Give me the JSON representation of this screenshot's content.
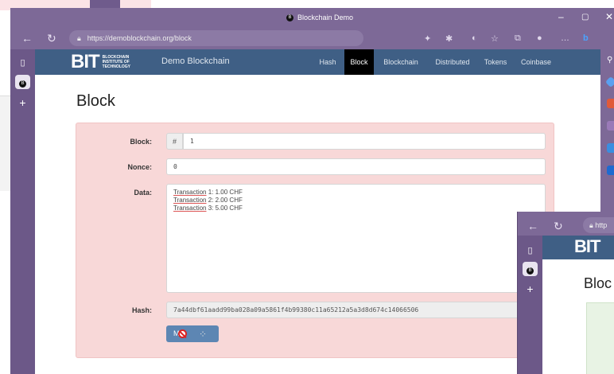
{
  "window": {
    "title": "Blockchain Demo",
    "controls": {
      "minimize": "–",
      "maximize": "▢",
      "close": "✕"
    },
    "url": "https://demoblockchain.org/block"
  },
  "site": {
    "logo_text": "BIT",
    "logo_sub": "BLOCKCHAIN INSTITUTE OF TECHNOLOGY",
    "name": "Demo Blockchain",
    "menu": [
      "Hash",
      "Block",
      "Blockchain",
      "Distributed",
      "Tokens",
      "Coinbase"
    ],
    "active_menu": "Block"
  },
  "page": {
    "title": "Block",
    "block_label": "Block:",
    "block_prefix": "#",
    "block_value": "1",
    "nonce_label": "Nonce:",
    "nonce_value": "0",
    "data_label": "Data:",
    "data_lines": [
      {
        "word": "Transaction",
        "rest": " 1: 1.00 CHF"
      },
      {
        "word": "Transaction",
        "rest": " 2: 2.00 CHF"
      },
      {
        "word": "Transaction",
        "rest": " 3: 5.00 CHF"
      }
    ],
    "hash_label": "Hash:",
    "hash_value": "7a44dbf61aadd99ba028a09a5861f4b99380c11a65212a5a3d8d674c14066506",
    "mine_label": "M"
  },
  "second_window": {
    "url_partial": "http",
    "logo_partial": "BIT",
    "title_partial": "Bloc"
  }
}
